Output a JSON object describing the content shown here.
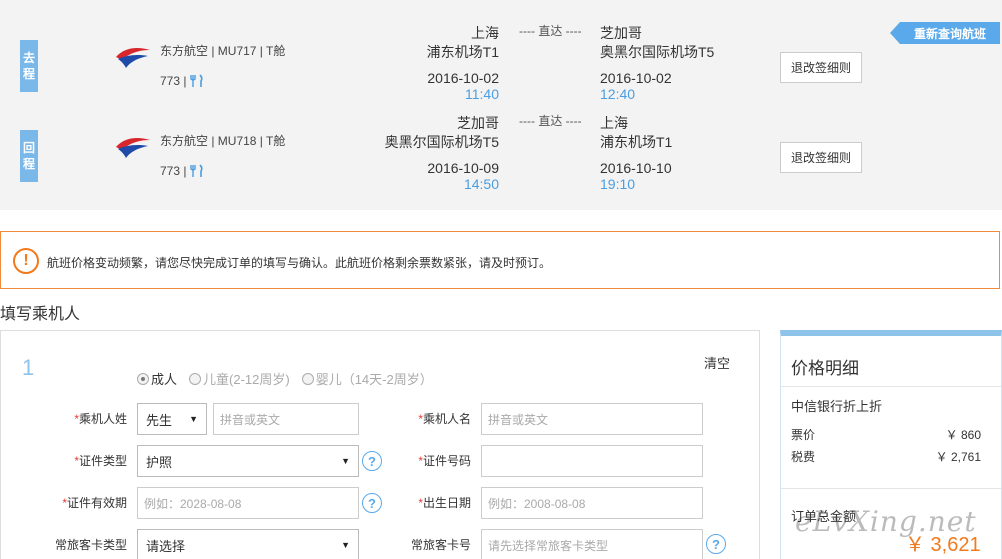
{
  "requery_label": "重新查询航班",
  "legs": [
    {
      "tag": "去程",
      "airline": "东方航空 | MU717 | T舱",
      "plane": "773 |",
      "dep_city": "上海",
      "dep_airport": "浦东机场T1",
      "dep_date": "2016-10-02",
      "dep_time": "11:40",
      "direct": "---- 直达 ----",
      "arr_city": "芝加哥",
      "arr_airport": "奥黑尔国际机场T5",
      "arr_date": "2016-10-02",
      "arr_time": "12:40",
      "rules_label": "退改签细则"
    },
    {
      "tag": "回程",
      "airline": "东方航空 | MU718 | T舱",
      "plane": "773 |",
      "dep_city": "芝加哥",
      "dep_airport": "奥黑尔国际机场T5",
      "dep_date": "2016-10-09",
      "dep_time": "14:50",
      "direct": "---- 直达 ----",
      "arr_city": "上海",
      "arr_airport": "浦东机场T1",
      "arr_date": "2016-10-10",
      "arr_time": "19:10",
      "rules_label": "退改签细则"
    }
  ],
  "warning": {
    "icon": "!",
    "text": "航班价格变动频繁，请您尽快完成订单的填写与确认。此航班价格剩余票数紧张，请及时预订。"
  },
  "section_title": "填写乘机人",
  "form": {
    "pax_no": "1",
    "clear_label": "清空",
    "types": [
      {
        "label": "成人",
        "checked": true
      },
      {
        "label": "儿童(2-12周岁)",
        "checked": false
      },
      {
        "label": "婴儿（14天-2周岁）",
        "checked": false
      }
    ],
    "surname_label": "乘机人姓",
    "title_select": "先生",
    "surname_placeholder": "拼音或英文",
    "given_label": "乘机人名",
    "given_placeholder": "拼音或英文",
    "id_type_label": "证件类型",
    "id_type_value": "护照",
    "id_no_label": "证件号码",
    "id_no_value": "",
    "id_expiry_label": "证件有效期",
    "id_expiry_placeholder": "例如：2028-08-08",
    "birth_label": "出生日期",
    "birth_placeholder": "例如：2008-08-08",
    "ff_type_label": "常旅客卡类型",
    "ff_type_value": "请选择",
    "ff_no_label": "常旅客卡号",
    "ff_no_placeholder": "请先选择常旅客卡类型",
    "req_mark": "*",
    "help": "?"
  },
  "price": {
    "title": "价格明细",
    "sub": "中信银行折上折",
    "ticket_label": "票价",
    "ticket_value": "￥ 860",
    "tax_label": "税费",
    "tax_value": "￥ 2,761",
    "total_label": "订单总金额",
    "total_value": "￥ 3,621"
  },
  "watermark": "eLvXing.net",
  "colors": {
    "accent": "#5aa9ea",
    "warn": "#f07a1d",
    "price": "#f07a1d"
  }
}
